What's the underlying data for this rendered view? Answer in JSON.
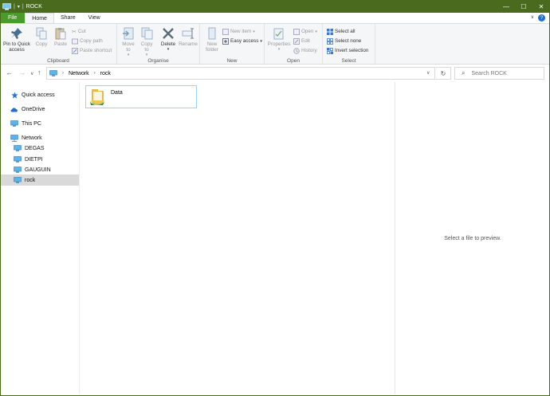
{
  "window": {
    "title": "ROCK",
    "controls": {
      "minimize": "—",
      "maximize": "☐",
      "close": "✕"
    }
  },
  "colors": {
    "titlebar": "#4a6a1e",
    "file_tab": "#4c9a2a",
    "selection": "#d9d9d9",
    "accent_blue": "#1f6fd0"
  },
  "tabs": [
    {
      "label": "File"
    },
    {
      "label": "Home"
    },
    {
      "label": "Share"
    },
    {
      "label": "View"
    }
  ],
  "ribbon": {
    "clipboard": {
      "label": "Clipboard",
      "pin": "Pin to Quick",
      "pin2": "access",
      "copy": "Copy",
      "paste": "Paste",
      "cut": "Cut",
      "copy_path": "Copy path",
      "paste_shortcut": "Paste shortcut"
    },
    "organise": {
      "label": "Organise",
      "move_to": "Move",
      "move_to2": "to",
      "copy_to": "Copy",
      "copy_to2": "to",
      "delete": "Delete",
      "rename": "Rename"
    },
    "new": {
      "label": "New",
      "new_folder": "New",
      "new_folder2": "folder",
      "new_item": "New item",
      "easy_access": "Easy access"
    },
    "open": {
      "label": "Open",
      "properties": "Properties",
      "open": "Open",
      "edit": "Edit",
      "history": "History"
    },
    "select": {
      "label": "Select",
      "select_all": "Select all",
      "select_none": "Select none",
      "invert": "Invert selection"
    }
  },
  "address": {
    "crumbs": [
      "Network",
      "rock"
    ],
    "search_placeholder": "Search ROCK"
  },
  "nav": {
    "items": [
      {
        "label": "Quick access",
        "icon": "star-icon"
      },
      {
        "label": "OneDrive",
        "icon": "cloud-icon"
      },
      {
        "label": "This PC",
        "icon": "pc-icon"
      },
      {
        "label": "Network",
        "icon": "network-icon"
      },
      {
        "label": "DEGAS",
        "icon": "computer-icon"
      },
      {
        "label": "DIETPI",
        "icon": "computer-icon"
      },
      {
        "label": "GAUGUIN",
        "icon": "computer-icon"
      },
      {
        "label": "rock",
        "icon": "computer-icon"
      }
    ]
  },
  "content": {
    "items": [
      {
        "name": "Data",
        "icon": "shared-folder-icon"
      }
    ]
  },
  "preview": {
    "message": "Select a file to preview."
  }
}
